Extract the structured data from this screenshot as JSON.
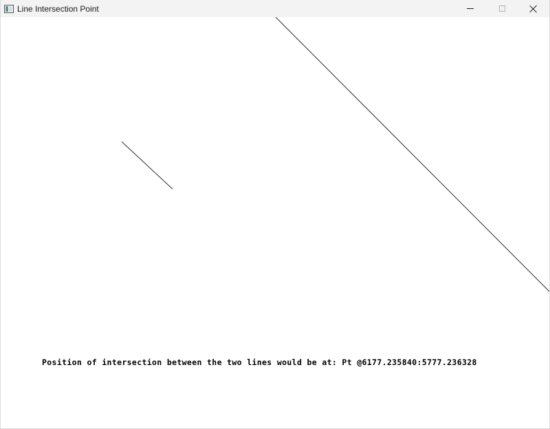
{
  "window": {
    "title": "Line Intersection Point",
    "icon": "app-window-icon",
    "controls": {
      "minimize": "minimize-icon",
      "maximize": "maximize-icon",
      "close": "close-icon"
    }
  },
  "canvas": {
    "background": "#ffffff",
    "line_color": "#2b2b2b",
    "message": "Position of intersection between the two lines would be at: Pt @6177.235840:5777.236328"
  }
}
